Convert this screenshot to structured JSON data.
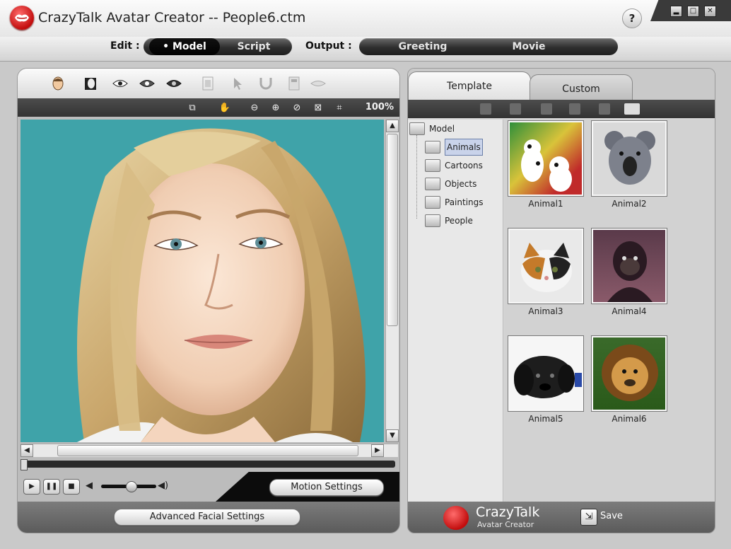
{
  "window": {
    "title": "CrazyTalk Avatar Creator -- People6.ctm",
    "help_glyph": "?",
    "controls": [
      "minimize-icon",
      "maximize-icon",
      "close-icon"
    ]
  },
  "modebar": {
    "edit_label": "Edit :",
    "edit_tabs": [
      {
        "label": "• Model",
        "active": true
      },
      {
        "label": "Script",
        "active": false
      }
    ],
    "output_label": "Output :",
    "output_tabs": [
      {
        "label": "Greeting"
      },
      {
        "label": "Movie"
      }
    ]
  },
  "left": {
    "toolbar_icons": [
      "face-icon",
      "profile-mask-icon",
      "eye-icon",
      "eye-dark-icon",
      "eyes-icon",
      "frame-icon",
      "pointer-icon",
      "magnet-icon",
      "page-icon",
      "mouth-icon"
    ],
    "view_icons": [
      "fit-window-icon",
      "hand-pan-icon",
      "zoom-out-icon",
      "zoom-in-icon",
      "reset-icon",
      "fit-icon",
      "center-icon"
    ],
    "zoom": "100%",
    "playback": {
      "play_icon": "play-icon",
      "pause_icon": "pause-icon",
      "stop_icon": "stop-icon",
      "volume_level": 0.55
    },
    "motion_settings_label": "Motion Settings",
    "advanced_label": "Advanced Facial Settings"
  },
  "right": {
    "tabs": [
      {
        "label": "Template",
        "active": true
      },
      {
        "label": "Custom",
        "active": false
      }
    ],
    "tree": {
      "root": "Model",
      "items": [
        "Animals",
        "Cartoons",
        "Objects",
        "Paintings",
        "People"
      ],
      "selected": "Animals"
    },
    "thumbnails": [
      "Animal1",
      "Animal2",
      "Animal3",
      "Animal4",
      "Animal5",
      "Animal6"
    ],
    "brand_main": "CrazyTalk",
    "brand_sub": "Avatar Creator",
    "save_label": "Save"
  },
  "colors": {
    "accent_red": "#d01717",
    "dark_toolbar": "#3a3a3a",
    "photo_bg": "#40a6ab"
  }
}
